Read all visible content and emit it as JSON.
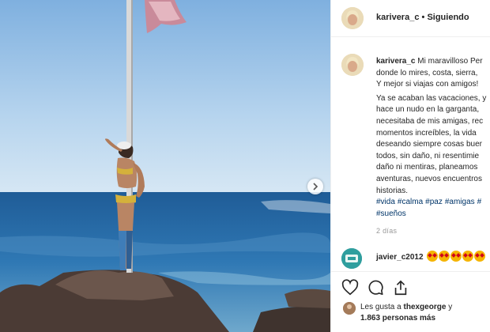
{
  "header": {
    "username": "karivera_c",
    "separator": "•",
    "follow_status": "Siguiendo"
  },
  "caption": {
    "username": "karivera_c",
    "line1": "Mi maravilloso Per",
    "lines_a": [
      "donde lo mires, costa, sierra,",
      "Y mejor si viajas con amigos!"
    ],
    "lines_b": [
      "Ya se acaban las vacaciones, y",
      "hace un nudo en la garganta,",
      "necesitaba de mis amigas, rec",
      "momentos increíbles, la vida",
      "deseando siempre cosas buer",
      "todos, sin daño, ni resentimie",
      "daño ni mentiras, planeamos",
      "aventuras, nuevos encuentros",
      "historias."
    ],
    "hashtags_row1": [
      "#vida",
      "#calma",
      "#paz",
      "#amigas",
      "#"
    ],
    "hashtags_row2": [
      "#sueños"
    ]
  },
  "timestamp": "2 días",
  "comment": {
    "username": "javier_c2012",
    "emoji_count": 5
  },
  "likes": {
    "prefix": "Les gusta a",
    "user": "thexgeorge",
    "conj": "y",
    "count": "1.863 personas más"
  },
  "colors": {
    "hashtag": "#003569",
    "muted": "#999999",
    "border": "#efefef",
    "sea": "#2f6aa3",
    "sky": "#9cc3e6"
  },
  "icons": [
    "chevron-right-icon",
    "heart-icon",
    "comment-icon",
    "share-icon"
  ]
}
